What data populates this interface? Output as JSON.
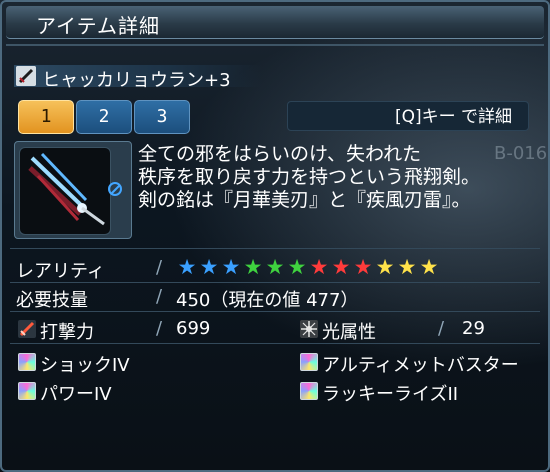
{
  "window": {
    "title": "アイテム詳細"
  },
  "item": {
    "name": "ヒャッカリョウラン+3",
    "description_lines": [
      "全ての邪をはらいのけ、失われた",
      "秩序を取り戻す力を持つという飛翔剣。",
      "剣の銘は『月華美刃』と『疾風刃雷』。"
    ]
  },
  "tabs": [
    {
      "label": "1",
      "active": true
    },
    {
      "label": "2",
      "active": false
    },
    {
      "label": "3",
      "active": false
    }
  ],
  "detail_button": {
    "label": "[Q]キー で詳細"
  },
  "background_text": {
    "code": "B-016"
  },
  "rarity": {
    "label": "レアリティ",
    "stars": 12,
    "star_colors": [
      "#3aa0ff",
      "#3aa0ff",
      "#3aa0ff",
      "#3fd23f",
      "#3fd23f",
      "#3fd23f",
      "#ff3b3b",
      "#ff3b3b",
      "#ff3b3b",
      "#ffe24a",
      "#ffe24a",
      "#ffe24a"
    ]
  },
  "requirement": {
    "label": "必要技量",
    "value": "450（現在の値 477）"
  },
  "stats": {
    "attack": {
      "label": "打撃力",
      "value": "699",
      "icon": "striking-power-icon"
    },
    "element": {
      "label": "光属性",
      "value": "29",
      "icon": "light-element-icon"
    }
  },
  "affixes": [
    "ショックIV",
    "アルティメットバスター",
    "パワーIV",
    "ラッキーライズII"
  ],
  "colors": {
    "active_tab": "#f0a530",
    "inactive_tab": "#2563a0",
    "no_trade": "#43a6ff"
  }
}
